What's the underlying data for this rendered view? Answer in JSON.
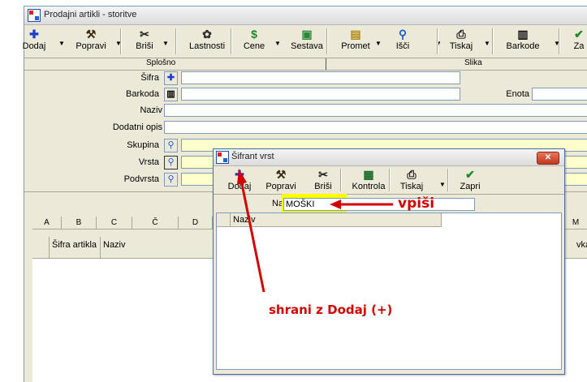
{
  "window": {
    "title": "Prodajni artikli - storitve"
  },
  "toolbar": [
    {
      "label": "Dodaj",
      "icon": "plus-icon",
      "glyph": "✚",
      "color": "#1a3fd0",
      "dropdown": true
    },
    {
      "label": "Popravi",
      "icon": "hammer-icon",
      "glyph": "⚒",
      "color": "#3a2a10",
      "dropdown": true
    },
    {
      "label": "Briši",
      "icon": "scissors-icon",
      "glyph": "✂",
      "color": "#222",
      "dropdown": true
    },
    {
      "label": "Lastnosti",
      "icon": "properties-icon",
      "glyph": "✿",
      "color": "#333",
      "dropdown": false
    },
    {
      "label": "Cene",
      "icon": "money-icon",
      "glyph": "$",
      "color": "#1a8a2a",
      "dropdown": true
    },
    {
      "label": "Sestava",
      "icon": "composition-icon",
      "glyph": "▣",
      "color": "#2a8a3a",
      "dropdown": false
    },
    {
      "label": "Promet",
      "icon": "traffic-icon",
      "glyph": "▤",
      "color": "#b08a10",
      "dropdown": true
    },
    {
      "label": "Išči",
      "icon": "search-icon",
      "glyph": "⚲",
      "color": "#1a5fd0",
      "dropdown": true
    },
    {
      "label": "Tiskaj",
      "icon": "printer-icon",
      "glyph": "⎙",
      "color": "#222",
      "dropdown": true
    },
    {
      "label": "Barkode",
      "icon": "barcode-icon",
      "glyph": "▥",
      "color": "#111",
      "dropdown": true
    },
    {
      "label": "Za",
      "icon": "check-icon",
      "glyph": "✔",
      "color": "#1a8a2a",
      "dropdown": false
    }
  ],
  "tabs": {
    "general": "Splošno",
    "image": "Slika"
  },
  "form": {
    "sifra": "Šifra",
    "barkoda": "Barkoda",
    "naziv": "Naziv",
    "dodatni_opis": "Dodatni opis",
    "skupina": "Skupina",
    "vrsta": "Vrsta",
    "podvrsta": "Podvrsta",
    "enota": "Enota"
  },
  "grid": {
    "letters": [
      "A",
      "B",
      "C",
      "Č",
      "D",
      "M"
    ],
    "columns": [
      "Šifra artikla",
      "Naziv",
      "vka"
    ]
  },
  "dialog": {
    "title": "Šifrant vrst",
    "toolbar": [
      {
        "label": "Dodaj",
        "icon": "plus-icon",
        "glyph": "✚",
        "color": "#1a3fd0",
        "dropdown": false
      },
      {
        "label": "Popravi",
        "icon": "hammer-icon",
        "glyph": "⚒",
        "color": "#3a2a10",
        "dropdown": false
      },
      {
        "label": "Briši",
        "icon": "scissors-icon",
        "glyph": "✂",
        "color": "#222",
        "dropdown": false
      },
      {
        "label": "Kontrola",
        "icon": "control-icon",
        "glyph": "▦",
        "color": "#1a6a2a",
        "dropdown": false
      },
      {
        "label": "Tiskaj",
        "icon": "printer-icon",
        "glyph": "⎙",
        "color": "#222",
        "dropdown": true
      },
      {
        "label": "Zapri",
        "icon": "check-icon",
        "glyph": "✔",
        "color": "#1a8a2a",
        "dropdown": false
      }
    ],
    "naziv_label": "Naziv",
    "naziv_value": "MOŠKI",
    "list_header": "Naziv",
    "close_glyph": "✕"
  },
  "annotations": {
    "vpisi": "vpiši",
    "shrani": "shrani z Dodaj (+)",
    "color": "#d40000",
    "highlight": "#ffff00"
  }
}
